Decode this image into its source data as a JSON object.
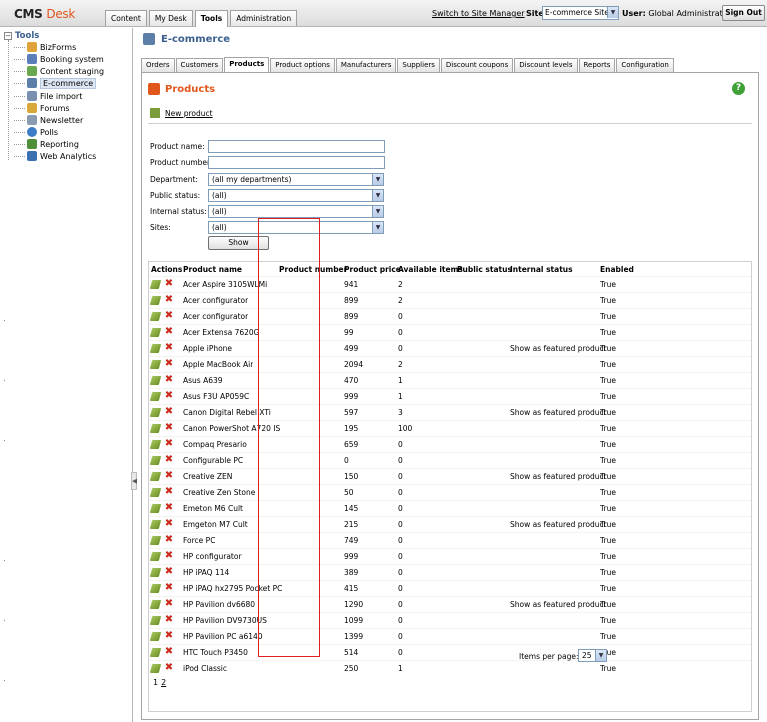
{
  "header": {
    "logo_cms": "CMS",
    "logo_desk": "Desk",
    "tabs": [
      {
        "label": "Content"
      },
      {
        "label": "My Desk"
      },
      {
        "label": "Tools"
      },
      {
        "label": "Administration"
      }
    ],
    "active_tab": "Tools",
    "switch_link": "Switch to Site Manager",
    "site_label": "Site:",
    "site_value": "E-commerce Site",
    "user_label": "User:",
    "user_value": "Global Administrator",
    "signout_label": "Sign Out"
  },
  "tree": {
    "root": "Tools",
    "items": [
      {
        "label": "BizForms",
        "icon": "bizforms-icon",
        "color": "#e0a33a"
      },
      {
        "label": "Booking system",
        "icon": "booking-icon",
        "color": "#5a7fb8"
      },
      {
        "label": "Content staging",
        "icon": "staging-icon",
        "color": "#6aa84f"
      },
      {
        "label": "E-commerce",
        "icon": "ecommerce-icon",
        "color": "#5b7fa8"
      },
      {
        "label": "File import",
        "icon": "file-import-icon",
        "color": "#7b8fb0"
      },
      {
        "label": "Forums",
        "icon": "forums-icon",
        "color": "#d9a73a"
      },
      {
        "label": "Newsletter",
        "icon": "newsletter-icon",
        "color": "#8a9bb3"
      },
      {
        "label": "Polls",
        "icon": "polls-icon",
        "color": "#3d7cc9"
      },
      {
        "label": "Reporting",
        "icon": "reporting-icon",
        "color": "#4f8f3a"
      },
      {
        "label": "Web Analytics",
        "icon": "analytics-icon",
        "color": "#3a6fb0"
      }
    ],
    "selected": "E-commerce"
  },
  "main": {
    "title": "E-commerce",
    "tabs": [
      {
        "label": "Orders"
      },
      {
        "label": "Customers"
      },
      {
        "label": "Products"
      },
      {
        "label": "Product options"
      },
      {
        "label": "Manufacturers"
      },
      {
        "label": "Suppliers"
      },
      {
        "label": "Discount coupons"
      },
      {
        "label": "Discount levels"
      },
      {
        "label": "Reports"
      },
      {
        "label": "Configuration"
      }
    ],
    "active_tab": "Products",
    "section_title": "Products",
    "new_product": "New product"
  },
  "filter": {
    "product_name_label": "Product name:",
    "product_name_value": "",
    "product_number_label": "Product number:",
    "product_number_value": "",
    "department_label": "Department:",
    "department_value": "(all my departments)",
    "public_status_label": "Public status:",
    "public_status_value": "(all)",
    "internal_status_label": "Internal status:",
    "internal_status_value": "(all)",
    "sites_label": "Sites:",
    "sites_value": "(all)",
    "show_label": "Show"
  },
  "grid": {
    "columns": {
      "actions": "Actions",
      "name": "Product name",
      "number": "Product number",
      "price": "Product price",
      "available": "Available items",
      "public": "Public status",
      "internal": "Internal status",
      "enabled": "Enabled"
    },
    "rows": [
      {
        "name": "Acer Aspire 3105WLMi",
        "number": "",
        "price": "941",
        "available": "2",
        "public": "",
        "internal": "",
        "enabled": "True"
      },
      {
        "name": "Acer configurator",
        "number": "",
        "price": "899",
        "available": "2",
        "public": "",
        "internal": "",
        "enabled": "True"
      },
      {
        "name": "Acer configurator",
        "number": "",
        "price": "899",
        "available": "0",
        "public": "",
        "internal": "",
        "enabled": "True"
      },
      {
        "name": "Acer Extensa 7620G",
        "number": "",
        "price": "99",
        "available": "0",
        "public": "",
        "internal": "",
        "enabled": "True"
      },
      {
        "name": "Apple iPhone",
        "number": "",
        "price": "499",
        "available": "0",
        "public": "",
        "internal": "Show as featured product",
        "enabled": "True"
      },
      {
        "name": "Apple MacBook Air",
        "number": "",
        "price": "2094",
        "available": "2",
        "public": "",
        "internal": "",
        "enabled": "True"
      },
      {
        "name": "Asus A639",
        "number": "",
        "price": "470",
        "available": "1",
        "public": "",
        "internal": "",
        "enabled": "True"
      },
      {
        "name": "Asus F3U AP059C",
        "number": "",
        "price": "999",
        "available": "1",
        "public": "",
        "internal": "",
        "enabled": "True"
      },
      {
        "name": "Canon Digital Rebel XTi",
        "number": "",
        "price": "597",
        "available": "3",
        "public": "",
        "internal": "Show as featured product",
        "enabled": "True"
      },
      {
        "name": "Canon PowerShot A720 IS",
        "number": "",
        "price": "195",
        "available": "100",
        "public": "",
        "internal": "",
        "enabled": "True"
      },
      {
        "name": "Compaq Presario",
        "number": "",
        "price": "659",
        "available": "0",
        "public": "",
        "internal": "",
        "enabled": "True"
      },
      {
        "name": "Configurable PC",
        "number": "",
        "price": "0",
        "available": "0",
        "public": "",
        "internal": "",
        "enabled": "True"
      },
      {
        "name": "Creative ZEN",
        "number": "",
        "price": "150",
        "available": "0",
        "public": "",
        "internal": "Show as featured product",
        "enabled": "True"
      },
      {
        "name": "Creative Zen Stone",
        "number": "",
        "price": "50",
        "available": "0",
        "public": "",
        "internal": "",
        "enabled": "True"
      },
      {
        "name": "Emeton M6 Cult",
        "number": "",
        "price": "145",
        "available": "0",
        "public": "",
        "internal": "",
        "enabled": "True"
      },
      {
        "name": "Emgeton M7 Cult",
        "number": "",
        "price": "215",
        "available": "0",
        "public": "",
        "internal": "Show as featured product",
        "enabled": "True"
      },
      {
        "name": "Force PC",
        "number": "",
        "price": "749",
        "available": "0",
        "public": "",
        "internal": "",
        "enabled": "True"
      },
      {
        "name": "HP configurator",
        "number": "",
        "price": "999",
        "available": "0",
        "public": "",
        "internal": "",
        "enabled": "True"
      },
      {
        "name": "HP iPAQ 114",
        "number": "",
        "price": "389",
        "available": "0",
        "public": "",
        "internal": "",
        "enabled": "True"
      },
      {
        "name": "HP iPAQ hx2795 Pocket PC",
        "number": "",
        "price": "415",
        "available": "0",
        "public": "",
        "internal": "",
        "enabled": "True"
      },
      {
        "name": "HP Pavilion dv6680",
        "number": "",
        "price": "1290",
        "available": "0",
        "public": "",
        "internal": "Show as featured product",
        "enabled": "True"
      },
      {
        "name": "HP Pavilion DV9730US",
        "number": "",
        "price": "1099",
        "available": "0",
        "public": "",
        "internal": "",
        "enabled": "True"
      },
      {
        "name": "HP Pavilion PC a6140",
        "number": "",
        "price": "1399",
        "available": "0",
        "public": "",
        "internal": "",
        "enabled": "True"
      },
      {
        "name": "HTC Touch P3450",
        "number": "",
        "price": "514",
        "available": "0",
        "public": "",
        "internal": "",
        "enabled": "True"
      },
      {
        "name": "iPod Classic",
        "number": "",
        "price": "250",
        "available": "1",
        "public": "",
        "internal": "",
        "enabled": "True"
      }
    ],
    "pages": [
      "1",
      "2"
    ],
    "items_per_page_label": "Items per page:",
    "items_per_page_value": "25"
  },
  "colors": {
    "accent": "#e0561b",
    "title_blue": "#3a5f8f",
    "highlight": "#e02020"
  }
}
